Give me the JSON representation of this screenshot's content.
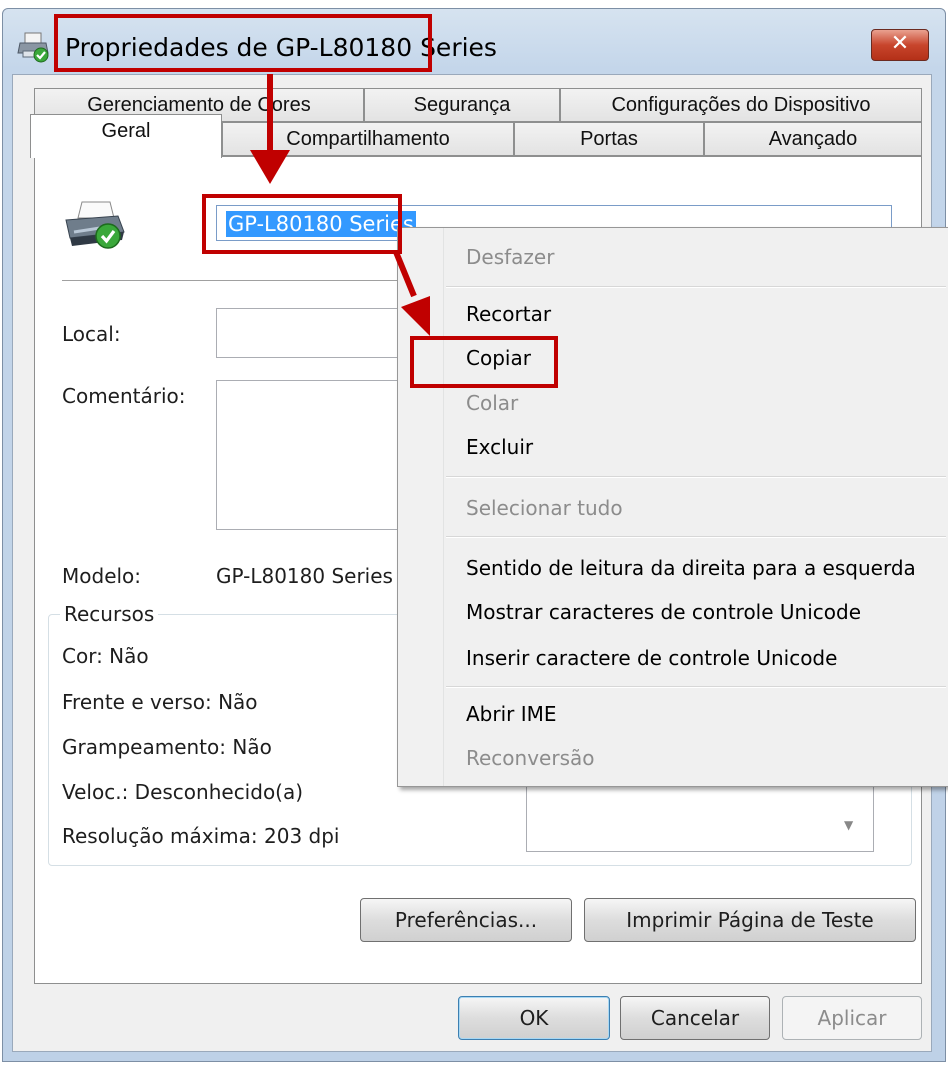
{
  "window": {
    "title": "Propriedades de GP-L80180 Series",
    "close_symbol": "✕"
  },
  "tabs": {
    "row_back": [
      "Gerenciamento de Cores",
      "Segurança",
      "Configurações do Dispositivo"
    ],
    "row_front": [
      "Geral",
      "Compartilhamento",
      "Portas",
      "Avançado"
    ],
    "active": "Geral"
  },
  "general": {
    "printer_name": "GP-L80180 Series",
    "location_label": "Local:",
    "comment_label": "Comentário:",
    "model_label": "Modelo:",
    "model_value": "GP-L80180 Series",
    "features_title": "Recursos",
    "features": [
      "Cor: Não",
      "Frente e verso: Não",
      "Grampeamento: Não",
      "Veloc.: Desconhecido(a)",
      "Resolução máxima: 203 dpi"
    ],
    "preferences_button": "Preferências...",
    "test_page_button": "Imprimir Página de Teste"
  },
  "footer": {
    "ok": "OK",
    "cancel": "Cancelar",
    "apply": "Aplicar"
  },
  "context_menu": {
    "undo": "Desfazer",
    "cut": "Recortar",
    "copy": "Copiar",
    "paste": "Colar",
    "delete": "Excluir",
    "select_all": "Selecionar tudo",
    "rtl": "Sentido de leitura da direita para a esquerda",
    "show_unicode": "Mostrar caracteres de controle Unicode",
    "insert_unicode": "Inserir caractere de controle Unicode",
    "open_ime": "Abrir IME",
    "reconversion": "Reconversão"
  },
  "colors": {
    "annotation_red": "#c00000",
    "selection_blue": "#3399ff",
    "status_green": "#3aa83a"
  }
}
